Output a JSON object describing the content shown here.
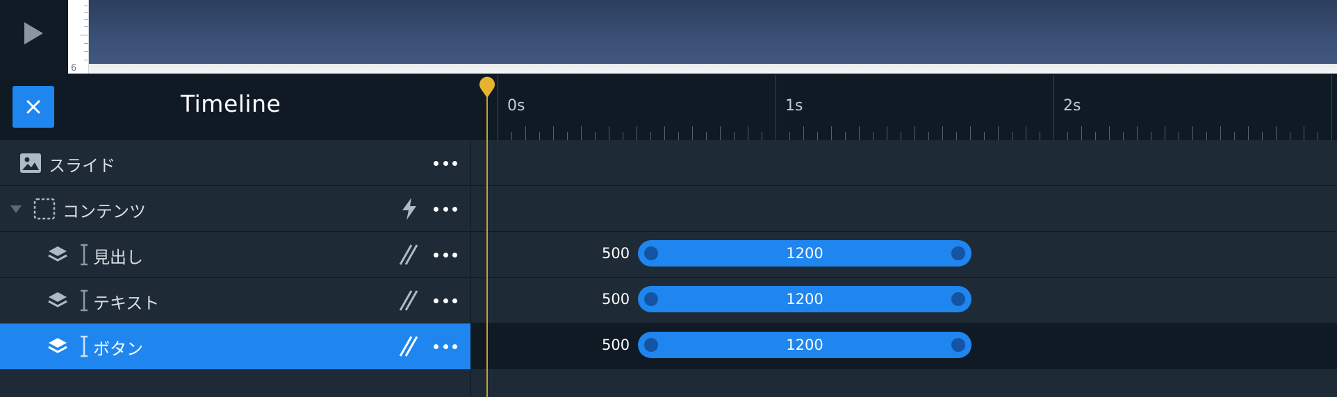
{
  "preview": {
    "ruler_number": "6"
  },
  "timeline": {
    "title": "Timeline",
    "time_labels": [
      "0s",
      "1s",
      "2s"
    ]
  },
  "layers": [
    {
      "label": "スライド",
      "indent": 0,
      "type": "slide",
      "trigger_icon": "",
      "selected": false
    },
    {
      "label": "コンテンツ",
      "indent": 0,
      "type": "group",
      "expanded": true,
      "trigger_icon": "bolt-icon",
      "selected": false
    },
    {
      "label": "見出し",
      "indent": 1,
      "type": "text",
      "trigger_icon": "parallel-lines-icon",
      "selected": false,
      "animation": {
        "delay": "500",
        "duration": "1200"
      }
    },
    {
      "label": "テキスト",
      "indent": 1,
      "type": "text",
      "trigger_icon": "parallel-lines-icon",
      "selected": false,
      "animation": {
        "delay": "500",
        "duration": "1200"
      }
    },
    {
      "label": "ボタン",
      "indent": 1,
      "type": "text",
      "trigger_icon": "parallel-lines-icon",
      "selected": true,
      "animation": {
        "delay": "500",
        "duration": "1200"
      }
    }
  ],
  "colors": {
    "accent": "#1f86f0",
    "playhead": "#e6b32e",
    "panel": "#1e2a35",
    "header": "#0f1a25"
  }
}
